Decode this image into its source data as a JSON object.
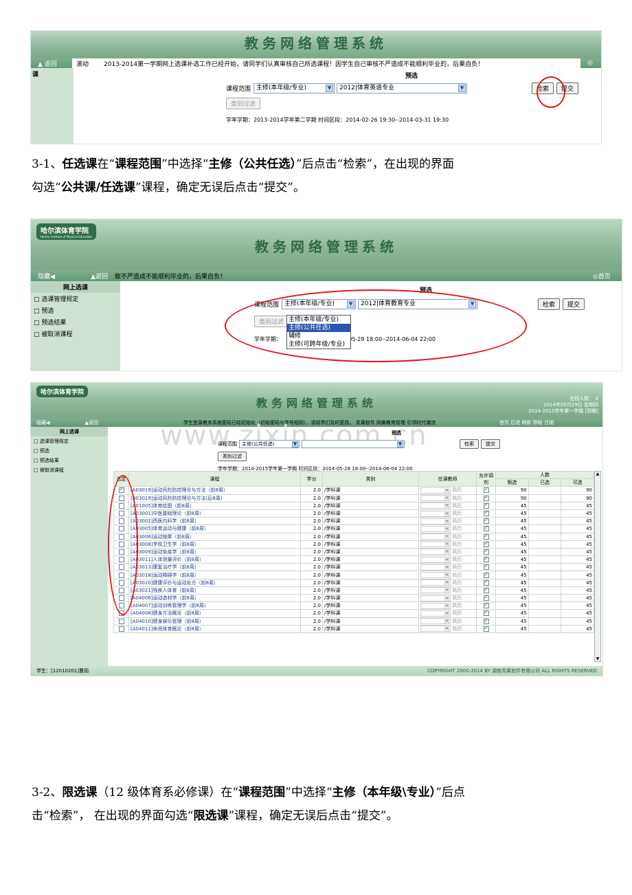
{
  "shot1": {
    "banner_title": "教务网络管理系统",
    "nav_back": "返回",
    "ticker_prefix": "滚动",
    "ticker": "2013-2014第一学期网上选课补选工作已经开始，请同学们认真审核自己所选课程！因学生自己审核不严造成不能顺利毕业的，后果自负！",
    "side_label": "课",
    "form_title": "预选",
    "range_label": "课程范围",
    "range_value": "主修(本年级/专业)",
    "major_value": "2012|体育英语专业",
    "search_btn": "检索",
    "submit_btn": "提交",
    "filter_btn": "类别过滤",
    "term_line": "学年学期：2013-2014学年第二学期  时间区段：2014-02-26 19:30--2014-03-31 19:30"
  },
  "para1": {
    "prefix": "3-1、",
    "b1": "任选课",
    "t1": "在“",
    "b2": "课程范围",
    "t2": "”中选择“",
    "b3": "主修（公共任选）",
    "t3": "”后点击“检索”，在出现的界面",
    "t4": "勾选“",
    "b4": "公共课/任选课",
    "t5": "”课程，确定无误后点击“提交”。"
  },
  "shot2": {
    "logo": "哈尔滨体育学院",
    "logo_en": "Harbin Institute of Physical Education",
    "banner_title": "教务网络管理系统",
    "nav_hide": "隐藏",
    "nav_back": "返回",
    "ticker": "致不严造成不能顺利毕业的，后果自负！",
    "home": "首页",
    "side_header": "网上选课",
    "side_items": [
      "选课管理规定",
      "预选",
      "预选结果",
      "被取消课程"
    ],
    "form_title": "预选",
    "range_label": "课程范围",
    "range_value": "主修(本年级/专业)",
    "major_value": "2012|体育教育专业",
    "options": [
      "主修(本年级/专业)",
      "主修(公共任选)",
      "辅修",
      "主修(可跨年级/专业)"
    ],
    "search_btn": "检索",
    "submit_btn": "提交",
    "filter_btn": "类别过滤",
    "term_prefix": "学年学期：",
    "term_suffix": "间区段：2014-05-28 18:00--2014-06-04 22:00"
  },
  "shot3": {
    "logo": "哈尔滨体育学院",
    "banner_title": "教务网络管理系统",
    "online": "在线人数： 4",
    "date": "2014年05月29日 星期四",
    "term": "2014-2015学年第一学期 [预期]",
    "nav_hide": "隐藏",
    "nav_back": "返回",
    "ticker": "学生登录教务系统密码已经初始化（初始密码与学号相同），请同学们及时更改。  青果软件  网桑教育管理 引领时代潮流",
    "nav_links": "首页 后退 刷新 帮助 注销",
    "side_header": "网上选课",
    "side_items": [
      "选课管理规定",
      "预选",
      "预选结果",
      "被取消课程"
    ],
    "form_title": "预选",
    "range_label": "课程范围",
    "range_value": "主修(公共任选)",
    "search_btn": "检索",
    "submit_btn": "提交",
    "filter_btn": "类别过滤",
    "term_line": "学年学期：2014-2015学年第一学期  时间区段：2014-05-28 18:00--2014-06-04 22:00",
    "watermark": "www.zixin.com.cn",
    "columns": {
      "check": "选定",
      "course": "课程",
      "credit": "学分",
      "type": "类别",
      "teacher": "任课教师",
      "adjust": "允许调剂",
      "people": "人数",
      "limit": "限选",
      "chosen": "已选",
      "avail": "可选"
    },
    "rows": [
      {
        "c": "[A03019]运动风险防控理论与方法（前8周）",
        "cr": "2.0",
        "t": "/学科课",
        "tc": "简历",
        "l": "90",
        "a": "90",
        "on": true
      },
      {
        "c": "[B03019]运动风险防控理论与方法(后8周)",
        "cr": "2.0",
        "t": "/学科课",
        "tc": "简历",
        "l": "90",
        "a": "90",
        "on": false
      },
      {
        "c": "[A01005]体育绘图（前8周）",
        "cr": "2.0",
        "t": "/学科课",
        "tc": "简历",
        "l": "45",
        "a": "45",
        "on": false
      },
      {
        "c": "[A03001]中医基础理论（前8周）",
        "cr": "2.0",
        "t": "/学科课",
        "tc": "简历",
        "l": "45",
        "a": "45",
        "on": false
      },
      {
        "c": "[A03002]西医内科学（前8周）",
        "cr": "2.0",
        "t": "/学科课",
        "tc": "简历",
        "l": "45",
        "a": "45",
        "on": false
      },
      {
        "c": "[A03005]体育运动与健康（前8周）",
        "cr": "2.0",
        "t": "/学科课",
        "tc": "简历",
        "l": "45",
        "a": "45",
        "on": false
      },
      {
        "c": "[A03006]运动按摩（前8周）",
        "cr": "2.0",
        "t": "/学科课",
        "tc": "简历",
        "l": "45",
        "a": "45",
        "on": false
      },
      {
        "c": "[A03008]学校卫生学（前8周）",
        "cr": "2.0",
        "t": "/学科课",
        "tc": "简历",
        "l": "45",
        "a": "45",
        "on": false
      },
      {
        "c": "[A03009]运动免疫学（前8周）",
        "cr": "2.0",
        "t": "/学科课",
        "tc": "简历",
        "l": "45",
        "a": "45",
        "on": false
      },
      {
        "c": "[A03011]人体测量评价（前8周）",
        "cr": "2.0",
        "t": "/学科课",
        "tc": "简历",
        "l": "45",
        "a": "45",
        "on": false
      },
      {
        "c": "[A03013]康复治疗学（前8周）",
        "cr": "2.0",
        "t": "/学科课",
        "tc": "简历",
        "l": "45",
        "a": "45",
        "on": false
      },
      {
        "c": "[A03018]运动障碍学（前8周）",
        "cr": "2.0",
        "t": "/学科课",
        "tc": "简历",
        "l": "45",
        "a": "45",
        "on": false
      },
      {
        "c": "[A03020]健康评价与运动处方（前8周）",
        "cr": "2.0",
        "t": "/学科课",
        "tc": "简历",
        "l": "45",
        "a": "45",
        "on": false
      },
      {
        "c": "[A03021]残疾人体育（前8周）",
        "cr": "2.0",
        "t": "/学科课",
        "tc": "简历",
        "l": "45",
        "a": "45",
        "on": false
      },
      {
        "c": "[A04006]运动选材学（前8周）",
        "cr": "2.0",
        "t": "/学科课",
        "tc": "简历",
        "l": "45",
        "a": "45",
        "on": false
      },
      {
        "c": "[A04007]运动训练管理学（前8周）",
        "cr": "2.0",
        "t": "/学科课",
        "tc": "简历",
        "l": "45",
        "a": "45",
        "on": false
      },
      {
        "c": "[A04008]健身方法概论（前8周）",
        "cr": "2.0",
        "t": "/学科课",
        "tc": "简历",
        "l": "45",
        "a": "45",
        "on": false
      },
      {
        "c": "[A04010]健身娱乐管理（前8周）",
        "cr": "2.0",
        "t": "/学科课",
        "tc": "简历",
        "l": "45",
        "a": "45",
        "on": false
      },
      {
        "c": "[A04011]休闲体育概论（前8周）",
        "cr": "2.0",
        "t": "/学科课",
        "tc": "简历",
        "l": "45",
        "a": "45",
        "on": false
      }
    ],
    "student": "学生：[12010201]曹雨",
    "copyright": "COPYRIGHT 2000-2014 BY 湖南青果软件有限公司 ALL RIGHTS RESERVED"
  },
  "para2": {
    "prefix": "3-2、",
    "b1": "限选课",
    "t1": "（12 级体育系必修课）在“",
    "b2": "课程范围",
    "t2": "”中选择“",
    "b3": "主修（本年级\\专业）",
    "t3": "”后点",
    "t4": "击“检索”， 在出现的界面勾选“",
    "b4": "限选课",
    "t5": "”课程，确定无误后点击“提交”。"
  }
}
